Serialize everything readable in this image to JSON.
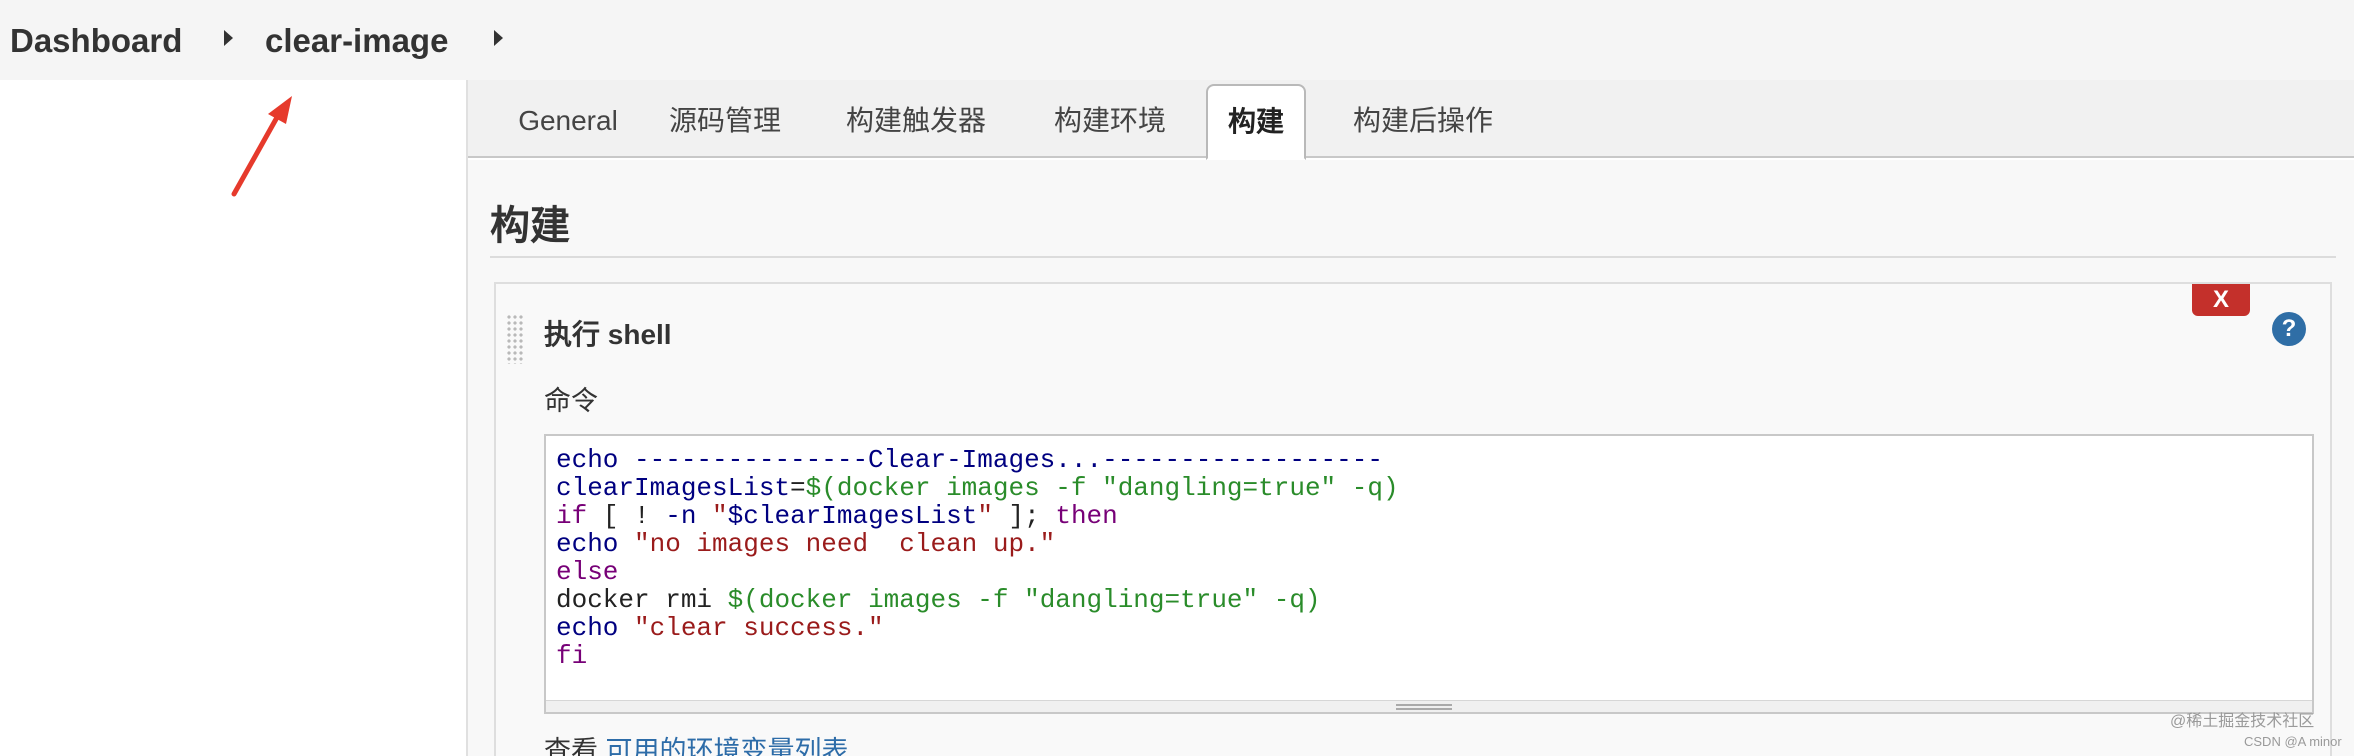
{
  "breadcrumb": {
    "items": [
      {
        "label": "Dashboard"
      },
      {
        "label": "clear-image"
      }
    ]
  },
  "colors": {
    "arrow": "#e63a2c",
    "delete_button": "#c4302b",
    "help_icon": "#2f6ea6",
    "link": "#2d6ca8"
  },
  "tabs": [
    {
      "label": "General",
      "active": false
    },
    {
      "label": "源码管理",
      "active": false
    },
    {
      "label": "构建触发器",
      "active": false
    },
    {
      "label": "构建环境",
      "active": false
    },
    {
      "label": "构建",
      "active": true
    },
    {
      "label": "构建后操作",
      "active": false
    }
  ],
  "section": {
    "title": "构建"
  },
  "build_step": {
    "title": "执行 shell",
    "delete_label": "X",
    "help_label": "?",
    "command_label": "命令",
    "command_lines": [
      [
        {
          "t": "echo ",
          "c": "kw"
        },
        {
          "t": "---------------Clear-Images...------------------",
          "c": "kw"
        }
      ],
      [
        {
          "t": "clearImagesList",
          "c": "var"
        },
        {
          "t": "=",
          "c": "plain"
        },
        {
          "t": "$(docker images -f \"dangling=true\" -q)",
          "c": "sub"
        }
      ],
      [
        {
          "t": "if",
          "c": "ctl"
        },
        {
          "t": " [ ! ",
          "c": "plain"
        },
        {
          "t": "-n",
          "c": "kw"
        },
        {
          "t": " \"",
          "c": "str"
        },
        {
          "t": "$clearImagesList",
          "c": "var"
        },
        {
          "t": "\"",
          "c": "str"
        },
        {
          "t": " ]; ",
          "c": "plain"
        },
        {
          "t": "then",
          "c": "ctl"
        }
      ],
      [
        {
          "t": "echo ",
          "c": "kw"
        },
        {
          "t": "\"no images need  clean up.\"",
          "c": "str"
        }
      ],
      [
        {
          "t": "else",
          "c": "ctl"
        }
      ],
      [
        {
          "t": "docker rmi ",
          "c": "plain"
        },
        {
          "t": "$(docker images -f \"dangling=true\" -q)",
          "c": "sub"
        }
      ],
      [
        {
          "t": "echo ",
          "c": "kw"
        },
        {
          "t": "\"clear success.\"",
          "c": "str"
        }
      ],
      [
        {
          "t": "fi",
          "c": "ctl"
        }
      ]
    ]
  },
  "env_vars": {
    "prefix": "查看 ",
    "link_label": "可用的环境变量列表"
  },
  "watermark": {
    "line1": "@稀土掘金技术社区",
    "line2": "CSDN @A minor"
  }
}
